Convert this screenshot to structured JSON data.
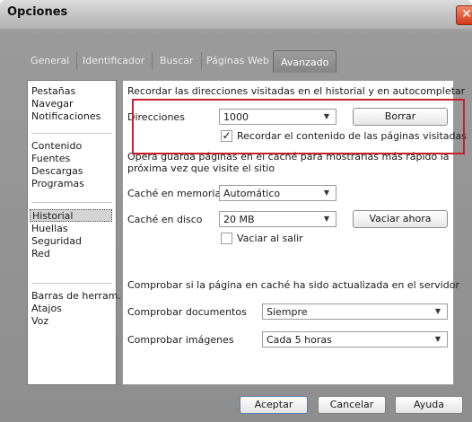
{
  "window": {
    "title": "Opciones",
    "close_icon": "close-icon"
  },
  "tabs": [
    {
      "label": "General"
    },
    {
      "label": "Identificador"
    },
    {
      "label": "Buscar"
    },
    {
      "label": "Páginas Web"
    },
    {
      "label": "Avanzado",
      "active": true
    }
  ],
  "sidebar": {
    "items": [
      "Pestañas",
      "Navegar",
      "Notificaciones",
      "Contenido",
      "Fuentes",
      "Descargas",
      "Programas",
      "Historial",
      "Huellas",
      "Seguridad",
      "Red",
      "Barras de herram.",
      "Atajos",
      "Voz"
    ],
    "selected": "Historial"
  },
  "history": {
    "intro": "Recordar las direcciones visitadas en el historial y en autocompletar",
    "addresses_label": "Direcciones",
    "addresses_value": "1000",
    "clear_button": "Borrar",
    "remember_content_label": "Recordar el contenido de las páginas visitadas",
    "remember_content_checked": true
  },
  "cache": {
    "description_line1": "Opera guarda páginas en el caché para mostrarlas más rápido la",
    "description_line2": "próxima vez que visite el sitio",
    "memory_label": "Caché en memoria",
    "memory_value": "Automático",
    "disk_label": "Caché en disco",
    "disk_value": "20 MB",
    "empty_now_button": "Vaciar ahora",
    "empty_on_exit_label": "Vaciar al salir",
    "empty_on_exit_checked": false
  },
  "check": {
    "heading": "Comprobar si la página en caché ha sido actualizada en el servidor",
    "documents_label": "Comprobar documentos",
    "documents_value": "Siempre",
    "images_label": "Comprobar imágenes",
    "images_value": "Cada 5 horas"
  },
  "footer": {
    "ok": "Aceptar",
    "cancel": "Cancelar",
    "help": "Ayuda"
  },
  "colors": {
    "highlight": "#c8202a"
  }
}
